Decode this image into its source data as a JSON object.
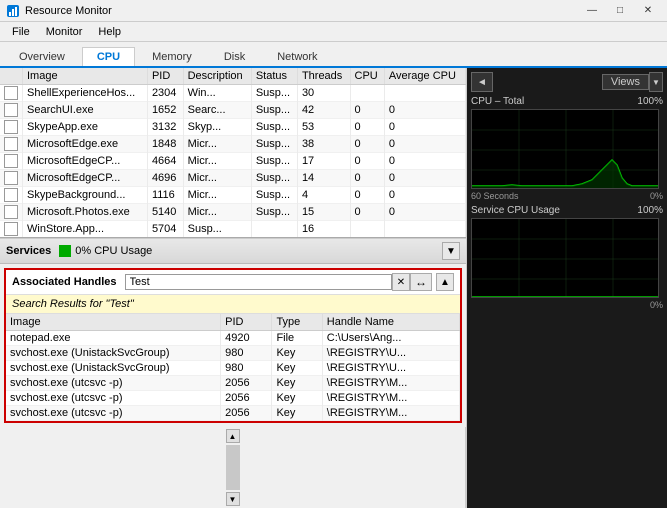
{
  "titleBar": {
    "title": "Resource Monitor",
    "minimizeLabel": "—",
    "maximizeLabel": "□",
    "closeLabel": "✕"
  },
  "menuBar": {
    "items": [
      "File",
      "Monitor",
      "Help"
    ]
  },
  "tabs": [
    {
      "label": "Overview",
      "active": false
    },
    {
      "label": "CPU",
      "active": true
    },
    {
      "label": "Memory",
      "active": false
    },
    {
      "label": "Disk",
      "active": false
    },
    {
      "label": "Network",
      "active": false
    }
  ],
  "processTable": {
    "columns": [
      "",
      "Image",
      "PID",
      "Description",
      "Status",
      "Threads",
      "CPU",
      "Average CPU"
    ],
    "rows": [
      {
        "image": "ShellExperienceHos...",
        "pid": "2304",
        "desc": "Win...",
        "status": "Susp...",
        "threads": "30",
        "cpu": "",
        "avgcpu": ""
      },
      {
        "image": "SearchUI.exe",
        "pid": "1652",
        "desc": "Searc...",
        "status": "Susp...",
        "threads": "42",
        "cpu": "0",
        "avgcpu": "0"
      },
      {
        "image": "SkypeApp.exe",
        "pid": "3132",
        "desc": "Skyp...",
        "status": "Susp...",
        "threads": "53",
        "cpu": "0",
        "avgcpu": "0"
      },
      {
        "image": "MicrosoftEdge.exe",
        "pid": "1848",
        "desc": "Micr...",
        "status": "Susp...",
        "threads": "38",
        "cpu": "0",
        "avgcpu": "0"
      },
      {
        "image": "MicrosoftEdgeCP...",
        "pid": "4664",
        "desc": "Micr...",
        "status": "Susp...",
        "threads": "17",
        "cpu": "0",
        "avgcpu": "0"
      },
      {
        "image": "MicrosoftEdgeCP...",
        "pid": "4696",
        "desc": "Micr...",
        "status": "Susp...",
        "threads": "14",
        "cpu": "0",
        "avgcpu": "0"
      },
      {
        "image": "SkypeBackground...",
        "pid": "1116",
        "desc": "Micr...",
        "status": "Susp...",
        "threads": "4",
        "cpu": "0",
        "avgcpu": "0"
      },
      {
        "image": "Microsoft.Photos.exe",
        "pid": "5140",
        "desc": "Micr...",
        "status": "Susp...",
        "threads": "15",
        "cpu": "0",
        "avgcpu": "0"
      },
      {
        "image": "WinStore.App...",
        "pid": "5704",
        "desc": "Susp...",
        "status": "",
        "threads": "16",
        "cpu": "",
        "avgcpu": ""
      }
    ]
  },
  "servicesSection": {
    "title": "Services",
    "cpuUsage": "0% CPU Usage",
    "collapseArrow": "▼"
  },
  "handlesSection": {
    "title": "Associated Handles",
    "searchValue": "Test",
    "clearIcon": "✕",
    "refreshIcon": "↔",
    "searchResultsLabel": "Search Results for \"Test\"",
    "columns": [
      "Image",
      "PID",
      "Type",
      "Handle Name"
    ],
    "rows": [
      {
        "image": "notepad.exe",
        "pid": "4920",
        "type": "File",
        "handleName": "C:\\Users\\Ang..."
      },
      {
        "image": "svchost.exe (UnistackSvcGroup)",
        "pid": "980",
        "type": "Key",
        "handleName": "\\REGISTRY\\U..."
      },
      {
        "image": "svchost.exe (UnistackSvcGroup)",
        "pid": "980",
        "type": "Key",
        "handleName": "\\REGISTRY\\U..."
      },
      {
        "image": "svchost.exe (utcsvc -p)",
        "pid": "2056",
        "type": "Key",
        "handleName": "\\REGISTRY\\M..."
      },
      {
        "image": "svchost.exe (utcsvc -p)",
        "pid": "2056",
        "type": "Key",
        "handleName": "\\REGISTRY\\M..."
      },
      {
        "image": "svchost.exe (utcsvc -p)",
        "pid": "2056",
        "type": "Key",
        "handleName": "\\REGISTRY\\M..."
      }
    ],
    "collapseArrow": "▲"
  },
  "rightPanel": {
    "navArrow": "◄",
    "viewsLabel": "Views",
    "viewsDropArrow": "▼",
    "cpuTotalChart": {
      "title": "CPU – Total",
      "maxPct": "100%",
      "bottomLeft": "60 Seconds",
      "bottomRight": "0%"
    },
    "serviceCpuChart": {
      "title": "Service CPU Usage",
      "maxPct": "100%",
      "bottomRight": "0%"
    }
  }
}
